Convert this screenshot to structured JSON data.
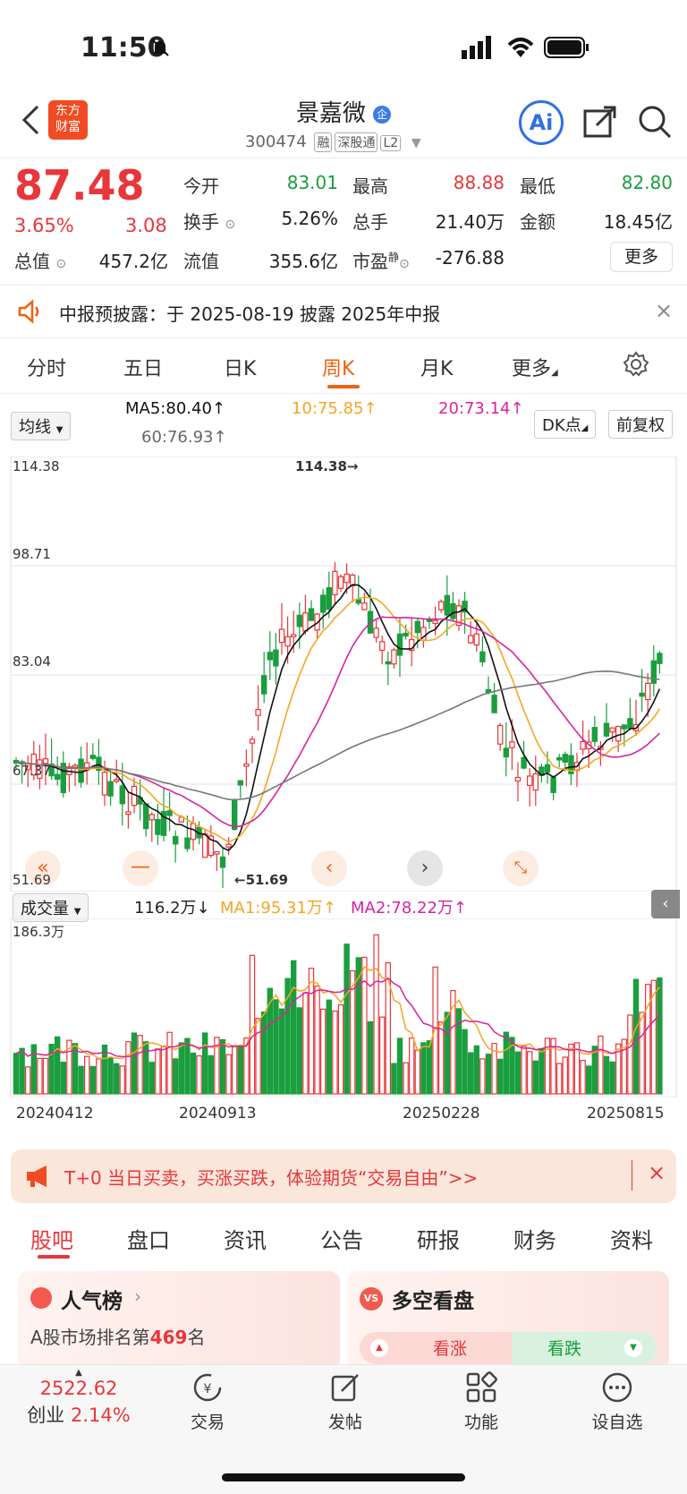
{
  "status": {
    "time": "11:50"
  },
  "header": {
    "logo_text_1": "东方",
    "logo_text_2": "财富",
    "title": "景嘉微",
    "title_badge": "企",
    "code": "300474",
    "tags": [
      "融",
      "深股通",
      "L2"
    ],
    "ai_label": "Ai"
  },
  "quote": {
    "price": "87.48",
    "change_pct": "3.65%",
    "change": "3.08",
    "open_label": "今开",
    "open": "83.01",
    "high_label": "最高",
    "high": "88.88",
    "low_label": "最低",
    "low": "82.80",
    "turnover_label": "换手",
    "turnover": "5.26%",
    "volume_label": "总手",
    "volume": "21.40万",
    "amount_label": "金额",
    "amount": "18.45亿",
    "mktcap_label": "总值",
    "mktcap": "457.2亿",
    "float_label": "流值",
    "float": "355.6亿",
    "pe_label": "市盈",
    "pe_sup": "静",
    "pe": "-276.88",
    "more_label": "更多"
  },
  "notice": {
    "text": "中报预披露：于 2025-08-19 披露 2025年中报"
  },
  "ktabs": [
    "分时",
    "五日",
    "日K",
    "周K",
    "月K",
    "更多"
  ],
  "ktab_active": "周K",
  "ma": {
    "selector": "均线",
    "ma5": "MA5:80.40",
    "ma10": "10:75.85",
    "ma20": "20:73.14",
    "ma60": "60:76.93",
    "dk": "DK点",
    "fq": "前复权"
  },
  "price_axis": [
    "114.38",
    "98.71",
    "83.04",
    "67.37",
    "51.69"
  ],
  "chart_annotations": {
    "high": "114.38→",
    "low": "←51.69"
  },
  "vol": {
    "selector": "成交量",
    "value": "116.2万",
    "ma1": "MA1:95.31万",
    "ma2": "MA2:78.22万",
    "axis_top": "186.3万"
  },
  "dates": [
    "20240412",
    "20240913",
    "20250228",
    "20250815"
  ],
  "colors": {
    "up": "#e8363a",
    "down": "#1a9e3e",
    "accent": "#f0620f",
    "ma5": "#111111",
    "ma10": "#f5a623",
    "ma20": "#d6249f",
    "ma60": "#777777"
  },
  "banner": {
    "text": "T+0 当日买卖，买涨买跌，体验期货“交易自由”>>"
  },
  "bottom_tabs": [
    "股吧",
    "盘口",
    "资讯",
    "公告",
    "研报",
    "财务",
    "资料"
  ],
  "bottom_active": "股吧",
  "cards": {
    "popular_title": "人气榜",
    "popular_rank_pre": "A股市场排名第",
    "popular_rank": "469",
    "popular_rank_post": "名",
    "vs_title": "多空看盘",
    "bull": "看涨",
    "bear": "看跌"
  },
  "bottom_nav": {
    "index_value": "2522.62",
    "index_name": "创业",
    "index_pct": "2.14%",
    "items": [
      "交易",
      "发帖",
      "功能",
      "设自选"
    ]
  }
}
